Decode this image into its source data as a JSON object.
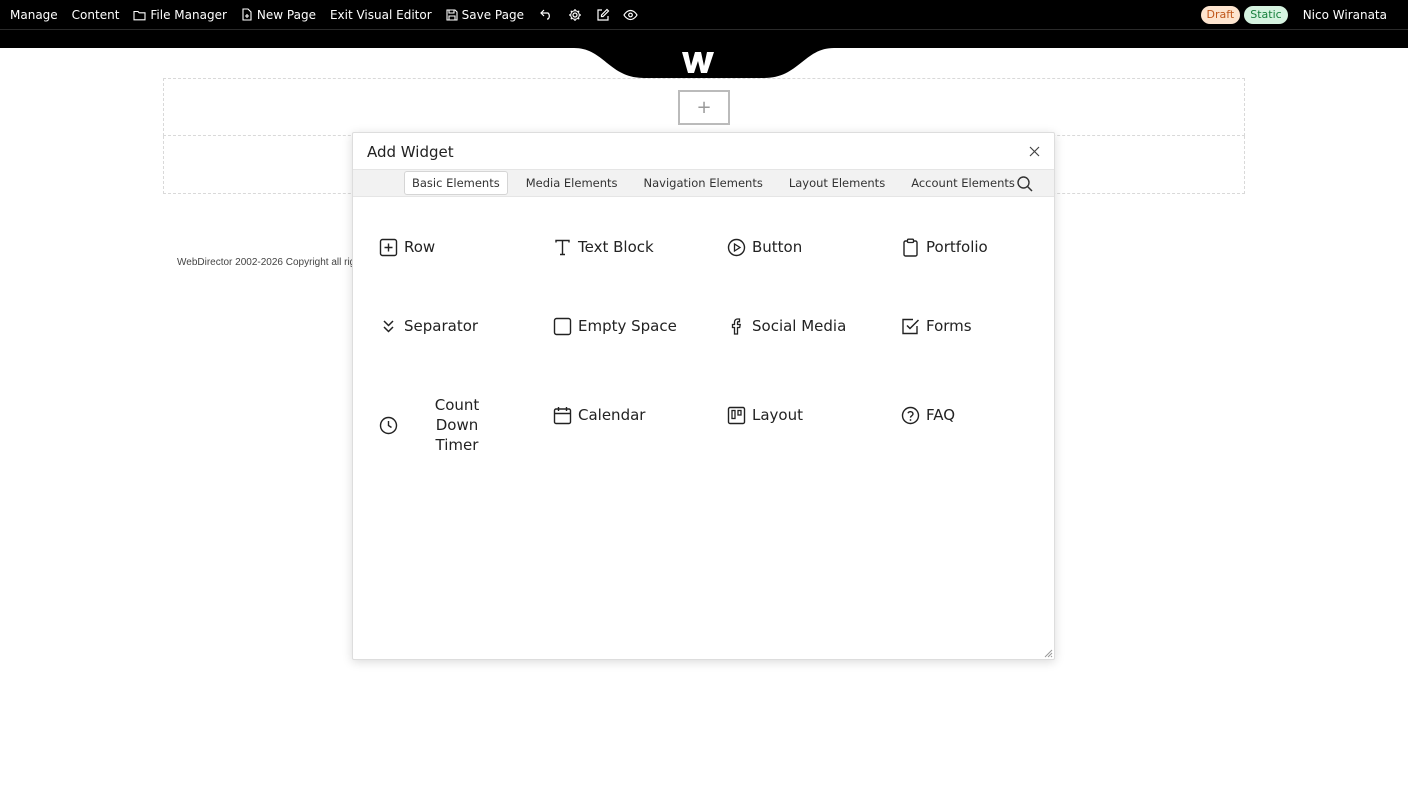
{
  "topbar": {
    "manage": "Manage",
    "content": "Content",
    "file_manager": "File Manager",
    "new_page": "New Page",
    "exit_visual_editor": "Exit Visual Editor",
    "save_page": "Save Page",
    "draft_badge": "Draft",
    "static_badge": "Static",
    "user_name": "Nico Wiranata"
  },
  "footer": {
    "copyright": "WebDirector 2002-2026 Copyright all righ"
  },
  "canvas": {
    "add_symbol": "+"
  },
  "modal": {
    "title": "Add Widget",
    "tabs": [
      "Basic Elements",
      "Media Elements",
      "Navigation Elements",
      "Layout Elements",
      "Account Elements"
    ],
    "active_tab": "Basic Elements",
    "widgets": [
      {
        "label": "Row",
        "icon": "plus-square-icon"
      },
      {
        "label": "Text Block",
        "icon": "text-icon"
      },
      {
        "label": "Button",
        "icon": "play-circle-icon"
      },
      {
        "label": "Portfolio",
        "icon": "clipboard-icon"
      },
      {
        "label": "Separator",
        "icon": "double-chevron-down-icon"
      },
      {
        "label": "Empty Space",
        "icon": "square-icon"
      },
      {
        "label": "Social Media",
        "icon": "facebook-icon"
      },
      {
        "label": "Forms",
        "icon": "check-square-icon"
      },
      {
        "label": "Count Down Timer",
        "icon": "clock-icon"
      },
      {
        "label": "Calendar",
        "icon": "calendar-icon"
      },
      {
        "label": "Layout",
        "icon": "layout-icon"
      },
      {
        "label": "FAQ",
        "icon": "help-circle-icon"
      }
    ]
  },
  "colors": {
    "topbar_bg": "#000000",
    "draft_bg": "#fde4cf",
    "draft_text": "#c0571b",
    "static_bg": "#d5f3e0",
    "static_text": "#17803d"
  }
}
